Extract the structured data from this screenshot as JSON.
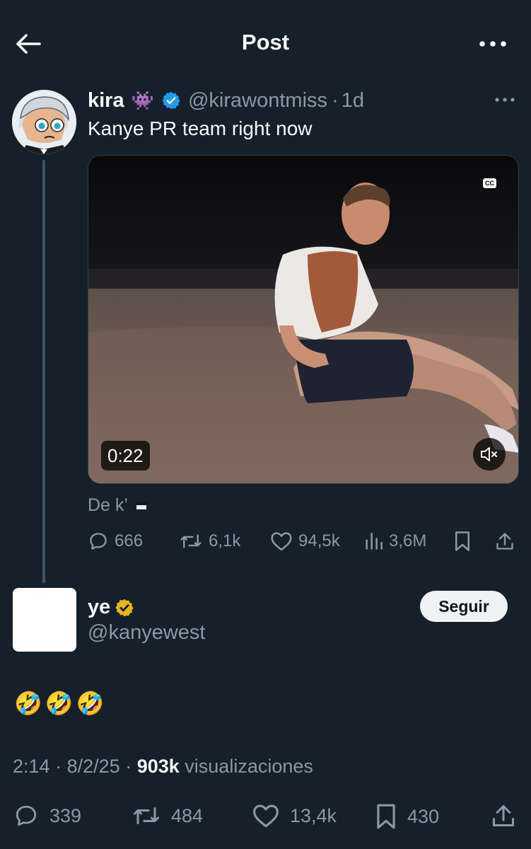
{
  "header": {
    "title": "Post",
    "back_icon": "arrow-left-icon",
    "more_icon": "ellipsis-icon"
  },
  "quoted_post": {
    "author_name": "kira",
    "author_emoji": "👾",
    "verified_badge_color": "#1d9bf0",
    "handle": "@kirawontmiss",
    "separator": "·",
    "time_ago": "1d",
    "text": "Kanye PR team right now",
    "video": {
      "duration": "0:22",
      "cc_label": "CC",
      "mute_icon": "volume-muted-icon"
    },
    "translation_note": "De k’",
    "actions": {
      "replies": "666",
      "reposts": "6,1k",
      "likes": "94,5k",
      "views": "3,6M"
    }
  },
  "main_post": {
    "author_name": "ye",
    "verified_badge_color": "#e2b719",
    "handle": "@kanyewest",
    "follow_label": "Seguir",
    "text": "🤣🤣🤣",
    "meta": {
      "time": "2:14",
      "date": "8/2/25",
      "separator": "·",
      "views_count": "903k",
      "views_label": "visualizaciones"
    },
    "actions": {
      "replies": "339",
      "reposts": "484",
      "likes": "13,4k",
      "bookmarks": "430"
    }
  },
  "colors": {
    "background": "#15202b",
    "text_primary": "#f7f9f9",
    "text_muted": "#8b98a5",
    "accent": "#1d9bf0"
  }
}
